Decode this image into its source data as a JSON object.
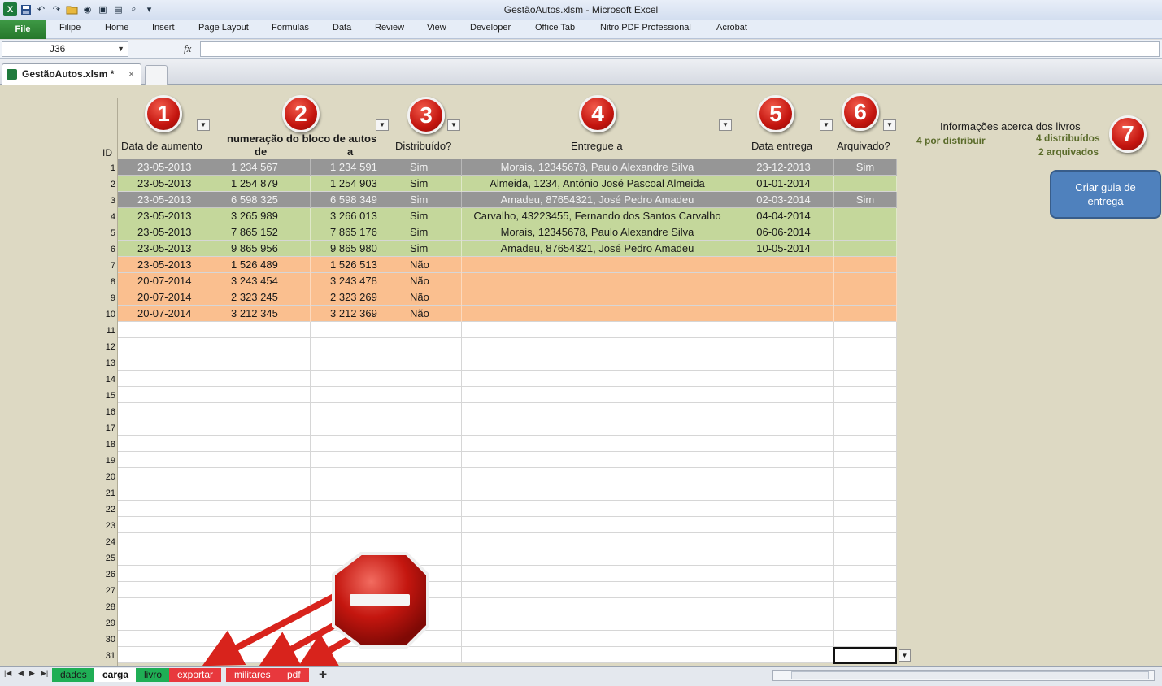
{
  "window": {
    "title": "GestãoAutos.xlsm  -  Microsoft Excel"
  },
  "ribbon": {
    "file_label": "File",
    "tabs": [
      "Filipe",
      "Home",
      "Insert",
      "Page Layout",
      "Formulas",
      "Data",
      "Review",
      "View",
      "Developer",
      "Office Tab",
      "Nitro PDF Professional",
      "Acrobat"
    ]
  },
  "formula_bar": {
    "cell_ref": "J36",
    "fx_label": "fx",
    "formula": ""
  },
  "doc_tab": {
    "name": "GestãoAutos.xlsm *",
    "close": "×"
  },
  "table": {
    "id_header": "ID",
    "columns": [
      {
        "title": "Data de aumento",
        "badge": "1"
      },
      {
        "title": "numeração do bloco de autos",
        "sub_from": "de",
        "sub_to": "a",
        "badge": "2"
      },
      {
        "title": "Distribuído?",
        "badge": "3"
      },
      {
        "title": "Entregue a",
        "badge": "4"
      },
      {
        "title": "Data entrega",
        "badge": "5"
      },
      {
        "title": "Arquivado?",
        "badge": "6"
      }
    ],
    "rows": [
      {
        "id": "1",
        "data": "23-05-2013",
        "de": "1 234 567",
        "a": "1 234 591",
        "dist": "Sim",
        "entregue": "Morais, 12345678, Paulo Alexandre Silva",
        "data_ent": "23-12-2013",
        "arq": "Sim",
        "color": "grey"
      },
      {
        "id": "2",
        "data": "23-05-2013",
        "de": "1 254 879",
        "a": "1 254 903",
        "dist": "Sim",
        "entregue": "Almeida, 1234, António José Pascoal Almeida",
        "data_ent": "01-01-2014",
        "arq": "",
        "color": "green"
      },
      {
        "id": "3",
        "data": "23-05-2013",
        "de": "6 598 325",
        "a": "6 598 349",
        "dist": "Sim",
        "entregue": "Amadeu, 87654321, José Pedro Amadeu",
        "data_ent": "02-03-2014",
        "arq": "Sim",
        "color": "grey"
      },
      {
        "id": "4",
        "data": "23-05-2013",
        "de": "3 265 989",
        "a": "3 266 013",
        "dist": "Sim",
        "entregue": "Carvalho, 43223455, Fernando dos Santos Carvalho",
        "data_ent": "04-04-2014",
        "arq": "",
        "color": "green"
      },
      {
        "id": "5",
        "data": "23-05-2013",
        "de": "7 865 152",
        "a": "7 865 176",
        "dist": "Sim",
        "entregue": "Morais, 12345678, Paulo Alexandre Silva",
        "data_ent": "06-06-2014",
        "arq": "",
        "color": "green"
      },
      {
        "id": "6",
        "data": "23-05-2013",
        "de": "9 865 956",
        "a": "9 865 980",
        "dist": "Sim",
        "entregue": "Amadeu, 87654321, José Pedro Amadeu",
        "data_ent": "10-05-2014",
        "arq": "",
        "color": "green"
      },
      {
        "id": "7",
        "data": "23-05-2013",
        "de": "1 526 489",
        "a": "1 526 513",
        "dist": "Não",
        "entregue": "",
        "data_ent": "",
        "arq": "",
        "color": "orange"
      },
      {
        "id": "8",
        "data": "20-07-2014",
        "de": "3 243 454",
        "a": "3 243 478",
        "dist": "Não",
        "entregue": "",
        "data_ent": "",
        "arq": "",
        "color": "orange"
      },
      {
        "id": "9",
        "data": "20-07-2014",
        "de": "2 323 245",
        "a": "2 323 269",
        "dist": "Não",
        "entregue": "",
        "data_ent": "",
        "arq": "",
        "color": "orange"
      },
      {
        "id": "10",
        "data": "20-07-2014",
        "de": "3 212 345",
        "a": "3 212 369",
        "dist": "Não",
        "entregue": "",
        "data_ent": "",
        "arq": "",
        "color": "orange"
      }
    ],
    "empty_row_ids": [
      "11",
      "12",
      "13",
      "14",
      "15",
      "16",
      "17",
      "18",
      "19",
      "20",
      "21",
      "22",
      "23",
      "24",
      "25",
      "26",
      "27",
      "28",
      "29",
      "30",
      "31"
    ]
  },
  "info_panel": {
    "title": "Informações acerca dos livros",
    "por_distribuir": "4 por distribuir",
    "distribuidos": "4 distribuídos",
    "arquivados": "2 arquivados",
    "badge": "7"
  },
  "button": {
    "label": "Criar guia de entrega"
  },
  "sheet_tabs": [
    {
      "label": "dados",
      "style": "green"
    },
    {
      "label": "carga",
      "style": "active"
    },
    {
      "label": "livro",
      "style": "green"
    },
    {
      "label": "exportar",
      "style": "red"
    },
    {
      "label": "militares",
      "style": "red"
    },
    {
      "label": "pdf",
      "style": "red"
    }
  ],
  "icons": {
    "stop_sign": "stop-sign-icon",
    "arrows": "red-arrow-icon"
  },
  "colors": {
    "grey_row": "#969696",
    "green_row": "#c4d79b",
    "orange_row": "#fabf8f",
    "badge_red": "#c4150f",
    "button_blue": "#4f81bd"
  }
}
